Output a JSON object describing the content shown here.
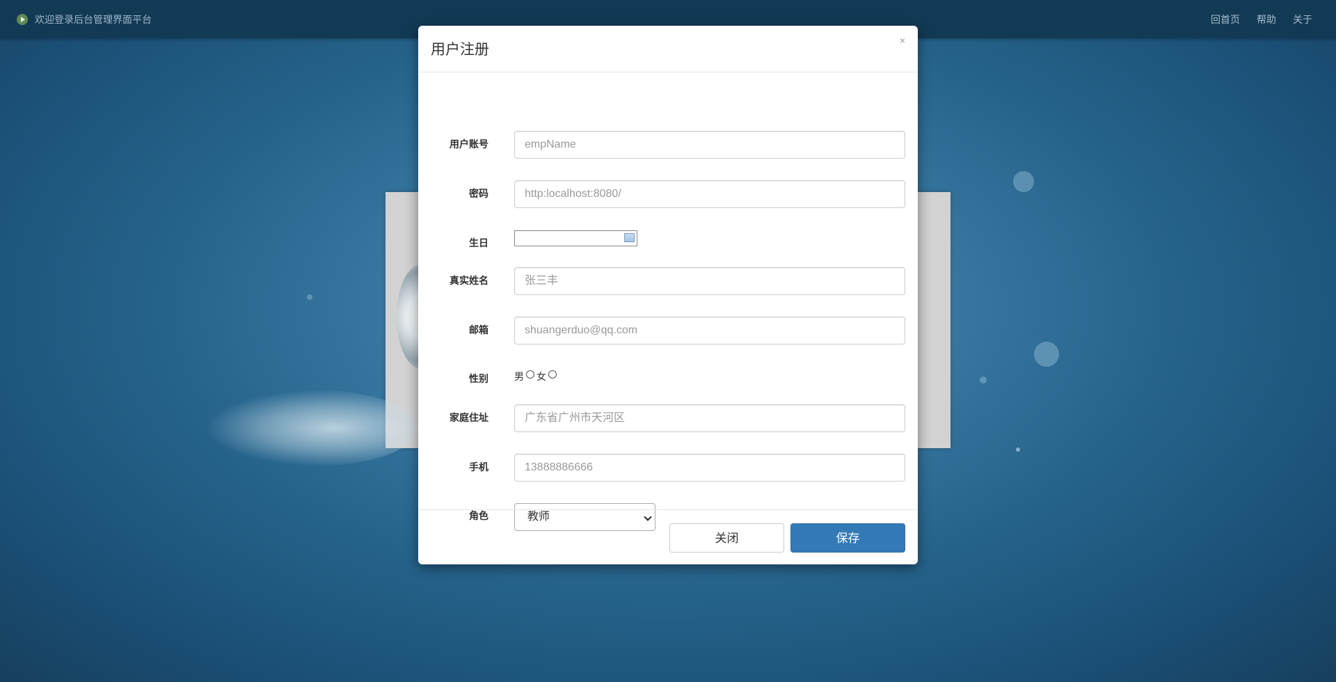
{
  "topbar": {
    "welcome_text": "欢迎登录后台管理界面平台",
    "icon": "play-circle-icon",
    "nav": [
      "回首页",
      "帮助",
      "关于"
    ]
  },
  "modal": {
    "title": "用户注册",
    "close_label": "×",
    "fields": {
      "account": {
        "label": "用户账号",
        "placeholder": "empName",
        "value": ""
      },
      "password": {
        "label": "密码",
        "placeholder": "http:localhost:8080/",
        "value": ""
      },
      "birthday": {
        "label": "生日",
        "value": "",
        "icon": "calendar-icon"
      },
      "realname": {
        "label": "真实姓名",
        "placeholder": "张三丰",
        "value": ""
      },
      "email": {
        "label": "邮箱",
        "placeholder": "shuangerduo@qq.com",
        "value": ""
      },
      "gender": {
        "label": "性别",
        "options": [
          "男",
          "女"
        ],
        "selected": null
      },
      "address": {
        "label": "家庭住址",
        "placeholder": "广东省广州市天河区",
        "value": ""
      },
      "phone": {
        "label": "手机",
        "placeholder": "13888886666",
        "value": ""
      },
      "role": {
        "label": "角色",
        "selected": "教师"
      }
    },
    "buttons": {
      "close": "关闭",
      "save": "保存"
    }
  },
  "colors": {
    "primary": "#337ab7",
    "topbar": "#123a55",
    "background": "#2a6a93"
  }
}
